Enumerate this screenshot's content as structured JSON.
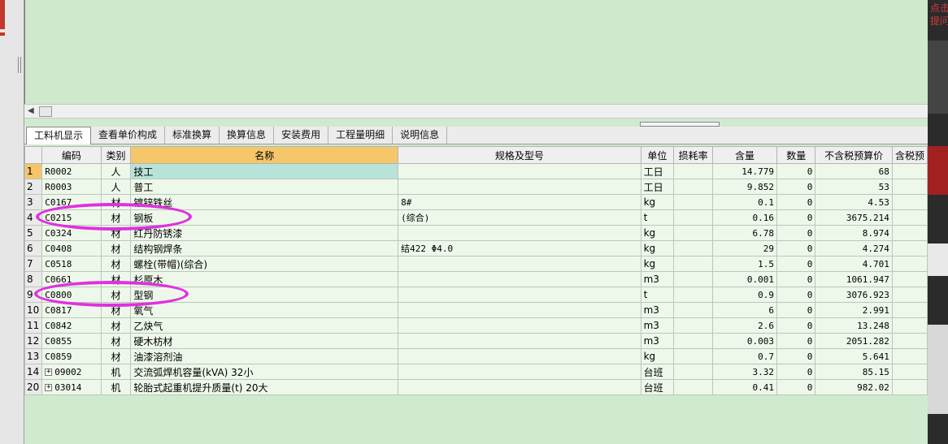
{
  "tabs": [
    "工料机显示",
    "查看单价构成",
    "标准换算",
    "换算信息",
    "安装费用",
    "工程量明细",
    "说明信息"
  ],
  "side_hint": "点击提问",
  "columns": [
    "编码",
    "类别",
    "名称",
    "规格及型号",
    "单位",
    "损耗率",
    "含量",
    "数量",
    "不含税预算价",
    "含税预"
  ],
  "rows": [
    {
      "no": "1",
      "code": "R0002",
      "type": "人",
      "name": "技工",
      "spec": "",
      "unit": "工日",
      "loss": "",
      "qty": "14.779",
      "amount": "0",
      "price": "68",
      "expand": false
    },
    {
      "no": "2",
      "code": "R0003",
      "type": "人",
      "name": "普工",
      "spec": "",
      "unit": "工日",
      "loss": "",
      "qty": "9.852",
      "amount": "0",
      "price": "53",
      "expand": false
    },
    {
      "no": "3",
      "code": "C0167",
      "type": "材",
      "name": "镀锌铁丝",
      "spec": "8#",
      "unit": "kg",
      "loss": "",
      "qty": "0.1",
      "amount": "0",
      "price": "4.53",
      "expand": false
    },
    {
      "no": "4",
      "code": "C0215",
      "type": "材",
      "name": "钢板",
      "spec": "(综合)",
      "unit": "t",
      "loss": "",
      "qty": "0.16",
      "amount": "0",
      "price": "3675.214",
      "expand": false
    },
    {
      "no": "5",
      "code": "C0324",
      "type": "材",
      "name": "红丹防锈漆",
      "spec": "",
      "unit": "kg",
      "loss": "",
      "qty": "6.78",
      "amount": "0",
      "price": "8.974",
      "expand": false
    },
    {
      "no": "6",
      "code": "C0408",
      "type": "材",
      "name": "结构钢焊条",
      "spec": "结422 Φ4.0",
      "unit": "kg",
      "loss": "",
      "qty": "29",
      "amount": "0",
      "price": "4.274",
      "expand": false
    },
    {
      "no": "7",
      "code": "C0518",
      "type": "材",
      "name": "螺栓(带帽)(综合)",
      "spec": "",
      "unit": "kg",
      "loss": "",
      "qty": "1.5",
      "amount": "0",
      "price": "4.701",
      "expand": false
    },
    {
      "no": "8",
      "code": "C0661",
      "type": "材",
      "name": "杉原木",
      "spec": "",
      "unit": "m3",
      "loss": "",
      "qty": "0.001",
      "amount": "0",
      "price": "1061.947",
      "expand": false
    },
    {
      "no": "9",
      "code": "C0800",
      "type": "材",
      "name": "型钢",
      "spec": "",
      "unit": "t",
      "loss": "",
      "qty": "0.9",
      "amount": "0",
      "price": "3076.923",
      "expand": false
    },
    {
      "no": "10",
      "code": "C0817",
      "type": "材",
      "name": "氧气",
      "spec": "",
      "unit": "m3",
      "loss": "",
      "qty": "6",
      "amount": "0",
      "price": "2.991",
      "expand": false
    },
    {
      "no": "11",
      "code": "C0842",
      "type": "材",
      "name": "乙炔气",
      "spec": "",
      "unit": "m3",
      "loss": "",
      "qty": "2.6",
      "amount": "0",
      "price": "13.248",
      "expand": false
    },
    {
      "no": "12",
      "code": "C0855",
      "type": "材",
      "name": "硬木枋材",
      "spec": "",
      "unit": "m3",
      "loss": "",
      "qty": "0.003",
      "amount": "0",
      "price": "2051.282",
      "expand": false
    },
    {
      "no": "13",
      "code": "C0859",
      "type": "材",
      "name": "油漆溶剂油",
      "spec": "",
      "unit": "kg",
      "loss": "",
      "qty": "0.7",
      "amount": "0",
      "price": "5.641",
      "expand": false
    },
    {
      "no": "14",
      "code": "09002",
      "type": "机",
      "name": "交流弧焊机容量(kVA) 32小",
      "spec": "",
      "unit": "台班",
      "loss": "",
      "qty": "3.32",
      "amount": "0",
      "price": "85.15",
      "expand": true
    },
    {
      "no": "20",
      "code": "03014",
      "type": "机",
      "name": "轮胎式起重机提升质量(t) 20大",
      "spec": "",
      "unit": "台班",
      "loss": "",
      "qty": "0.41",
      "amount": "0",
      "price": "982.02",
      "expand": true
    }
  ],
  "highlight_color": "#e030e0"
}
